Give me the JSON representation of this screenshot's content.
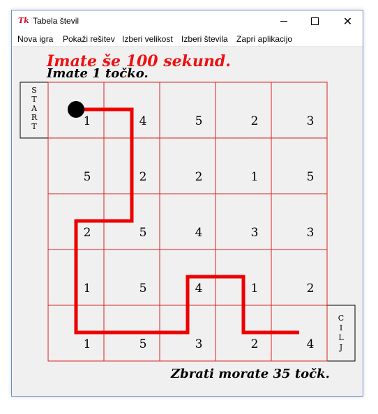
{
  "window": {
    "title": "Tabela števil",
    "icon": "tk-icon",
    "controls": [
      "minimize-icon",
      "maximize-icon",
      "close-icon"
    ]
  },
  "menu": {
    "items": [
      {
        "label": "Nova igra"
      },
      {
        "label": "Pokaži rešitev"
      },
      {
        "label": "Izberi velikost"
      },
      {
        "label": "Izberi števila"
      },
      {
        "label": "Zapri aplikacijo"
      }
    ]
  },
  "game": {
    "time_message": "Imate še 100 sekund.",
    "points_message": "Imate 1 točko.",
    "goal_message": "Zbrati morate 35 točk.",
    "start_label": "START",
    "end_label": "CILJ",
    "grid": [
      [
        1,
        4,
        5,
        2,
        3
      ],
      [
        5,
        2,
        2,
        1,
        5
      ],
      [
        2,
        5,
        4,
        3,
        3
      ],
      [
        1,
        5,
        4,
        1,
        2
      ],
      [
        1,
        5,
        3,
        2,
        4
      ]
    ],
    "path": [
      [
        0,
        0
      ],
      [
        0,
        1
      ],
      [
        1,
        1
      ],
      [
        2,
        1
      ],
      [
        2,
        0
      ],
      [
        3,
        0
      ],
      [
        4,
        0
      ],
      [
        4,
        1
      ],
      [
        4,
        2
      ],
      [
        3,
        2
      ],
      [
        3,
        3
      ],
      [
        4,
        3
      ],
      [
        4,
        4
      ]
    ],
    "player_cell": [
      0,
      0
    ],
    "colors": {
      "grid_line": "#dd2222",
      "path": "#ee0000",
      "time_text": "#ee1111",
      "player": "#000000"
    }
  }
}
